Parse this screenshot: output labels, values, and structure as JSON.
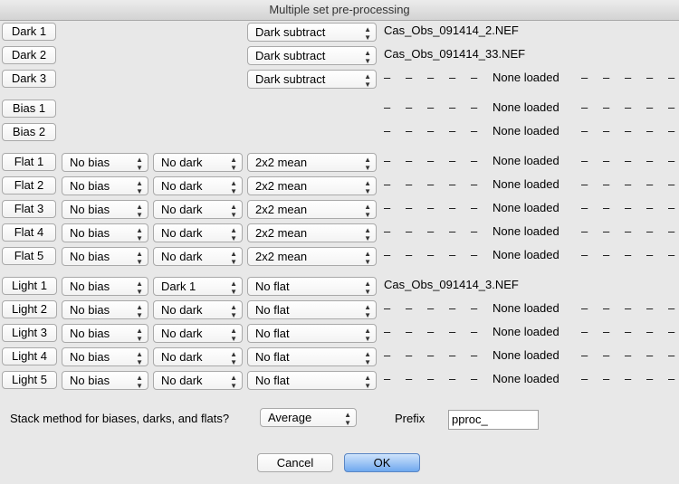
{
  "window": {
    "title": "Multiple set pre-processing"
  },
  "none_text": "None loaded",
  "dash": "–",
  "darks": [
    {
      "button": "Dark 1",
      "method": "Dark subtract",
      "file": "Cas_Obs_091414_2.NEF"
    },
    {
      "button": "Dark 2",
      "method": "Dark subtract",
      "file": "Cas_Obs_091414_33.NEF"
    },
    {
      "button": "Dark 3",
      "method": "Dark subtract",
      "file": ""
    }
  ],
  "biases": [
    {
      "button": "Bias 1",
      "file": ""
    },
    {
      "button": "Bias 2",
      "file": ""
    }
  ],
  "flats": [
    {
      "button": "Flat 1",
      "bias": "No bias",
      "dark": "No dark",
      "method": "2x2 mean",
      "file": ""
    },
    {
      "button": "Flat 2",
      "bias": "No bias",
      "dark": "No dark",
      "method": "2x2 mean",
      "file": ""
    },
    {
      "button": "Flat 3",
      "bias": "No bias",
      "dark": "No dark",
      "method": "2x2 mean",
      "file": ""
    },
    {
      "button": "Flat 4",
      "bias": "No bias",
      "dark": "No dark",
      "method": "2x2 mean",
      "file": ""
    },
    {
      "button": "Flat 5",
      "bias": "No bias",
      "dark": "No dark",
      "method": "2x2 mean",
      "file": ""
    }
  ],
  "lights": [
    {
      "button": "Light 1",
      "bias": "No bias",
      "dark": "Dark 1",
      "flat": "No flat",
      "file": "Cas_Obs_091414_3.NEF"
    },
    {
      "button": "Light 2",
      "bias": "No bias",
      "dark": "No dark",
      "flat": "No flat",
      "file": ""
    },
    {
      "button": "Light 3",
      "bias": "No bias",
      "dark": "No dark",
      "flat": "No flat",
      "file": ""
    },
    {
      "button": "Light 4",
      "bias": "No bias",
      "dark": "No dark",
      "flat": "No flat",
      "file": ""
    },
    {
      "button": "Light 5",
      "bias": "No bias",
      "dark": "No dark",
      "flat": "No flat",
      "file": ""
    }
  ],
  "footer": {
    "stack_label": "Stack method for biases, darks, and flats?",
    "stack_value": "Average",
    "prefix_label": "Prefix",
    "prefix_value": "pproc_",
    "cancel": "Cancel",
    "ok": "OK"
  }
}
